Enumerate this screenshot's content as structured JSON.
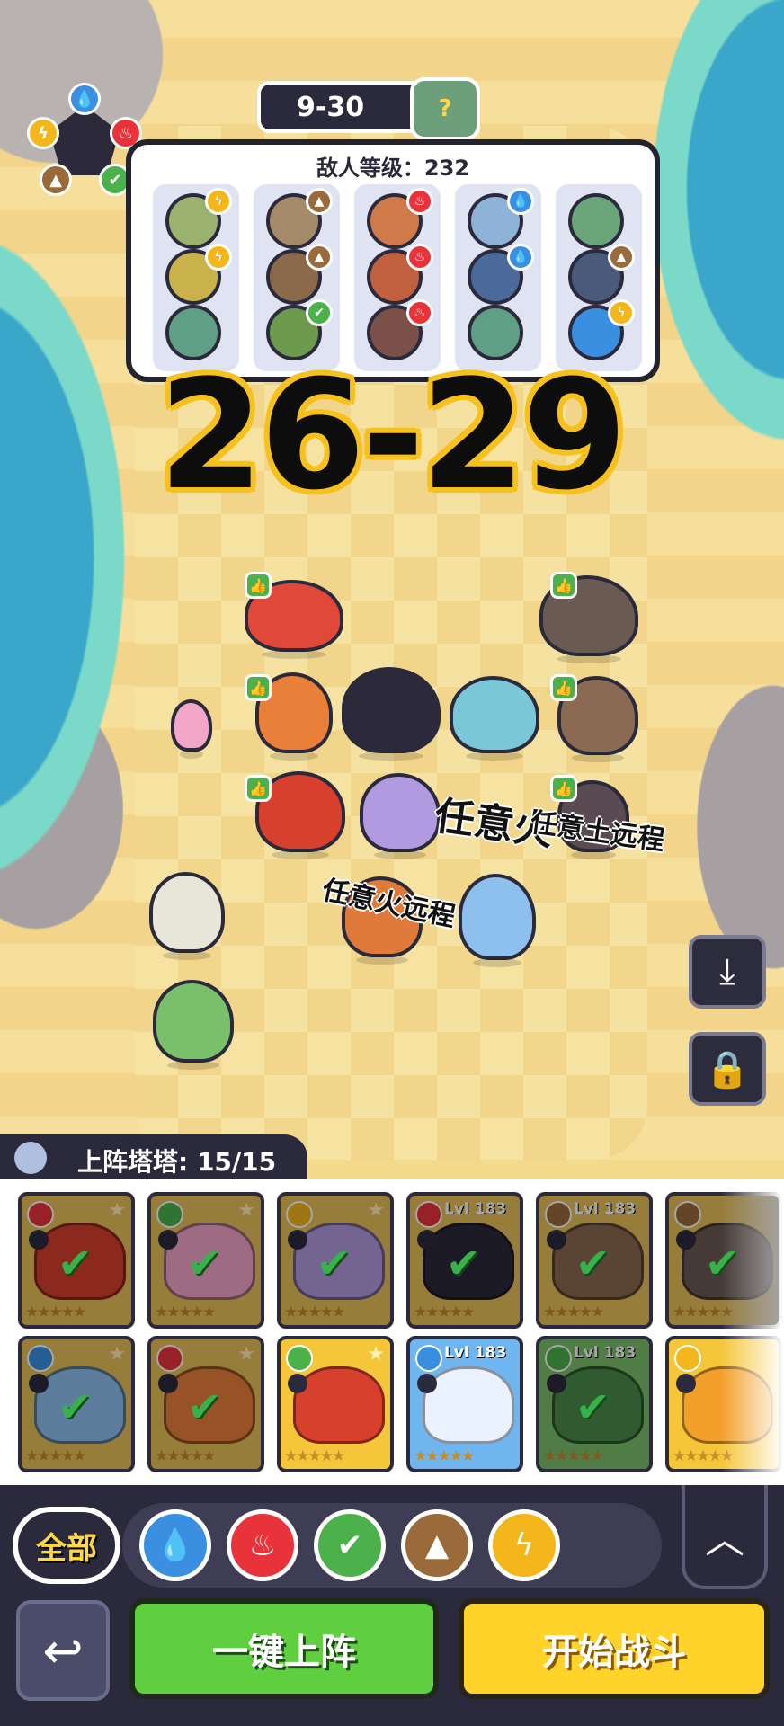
{
  "stage": {
    "label": "9-30",
    "boss_icon": "?"
  },
  "enemy_panel": {
    "title": "敌人等级：232"
  },
  "overlay": {
    "range": "26-29"
  },
  "annotations": {
    "fire": "任意火",
    "earth_ranged": "任意土远程",
    "fire_ranged": "任意火远程"
  },
  "roster": {
    "header": "上阵塔塔: 15/15",
    "lvl": "Lvl 183"
  },
  "filters": {
    "all_label": "全部"
  },
  "buttons": {
    "deploy": "一键上阵",
    "start": "开始战斗"
  },
  "colors": {
    "water": "#3b8fe0",
    "fire": "#e8333a",
    "grass": "#4cb14a",
    "earth": "#9a6a3a",
    "thunder": "#f3b71c"
  }
}
